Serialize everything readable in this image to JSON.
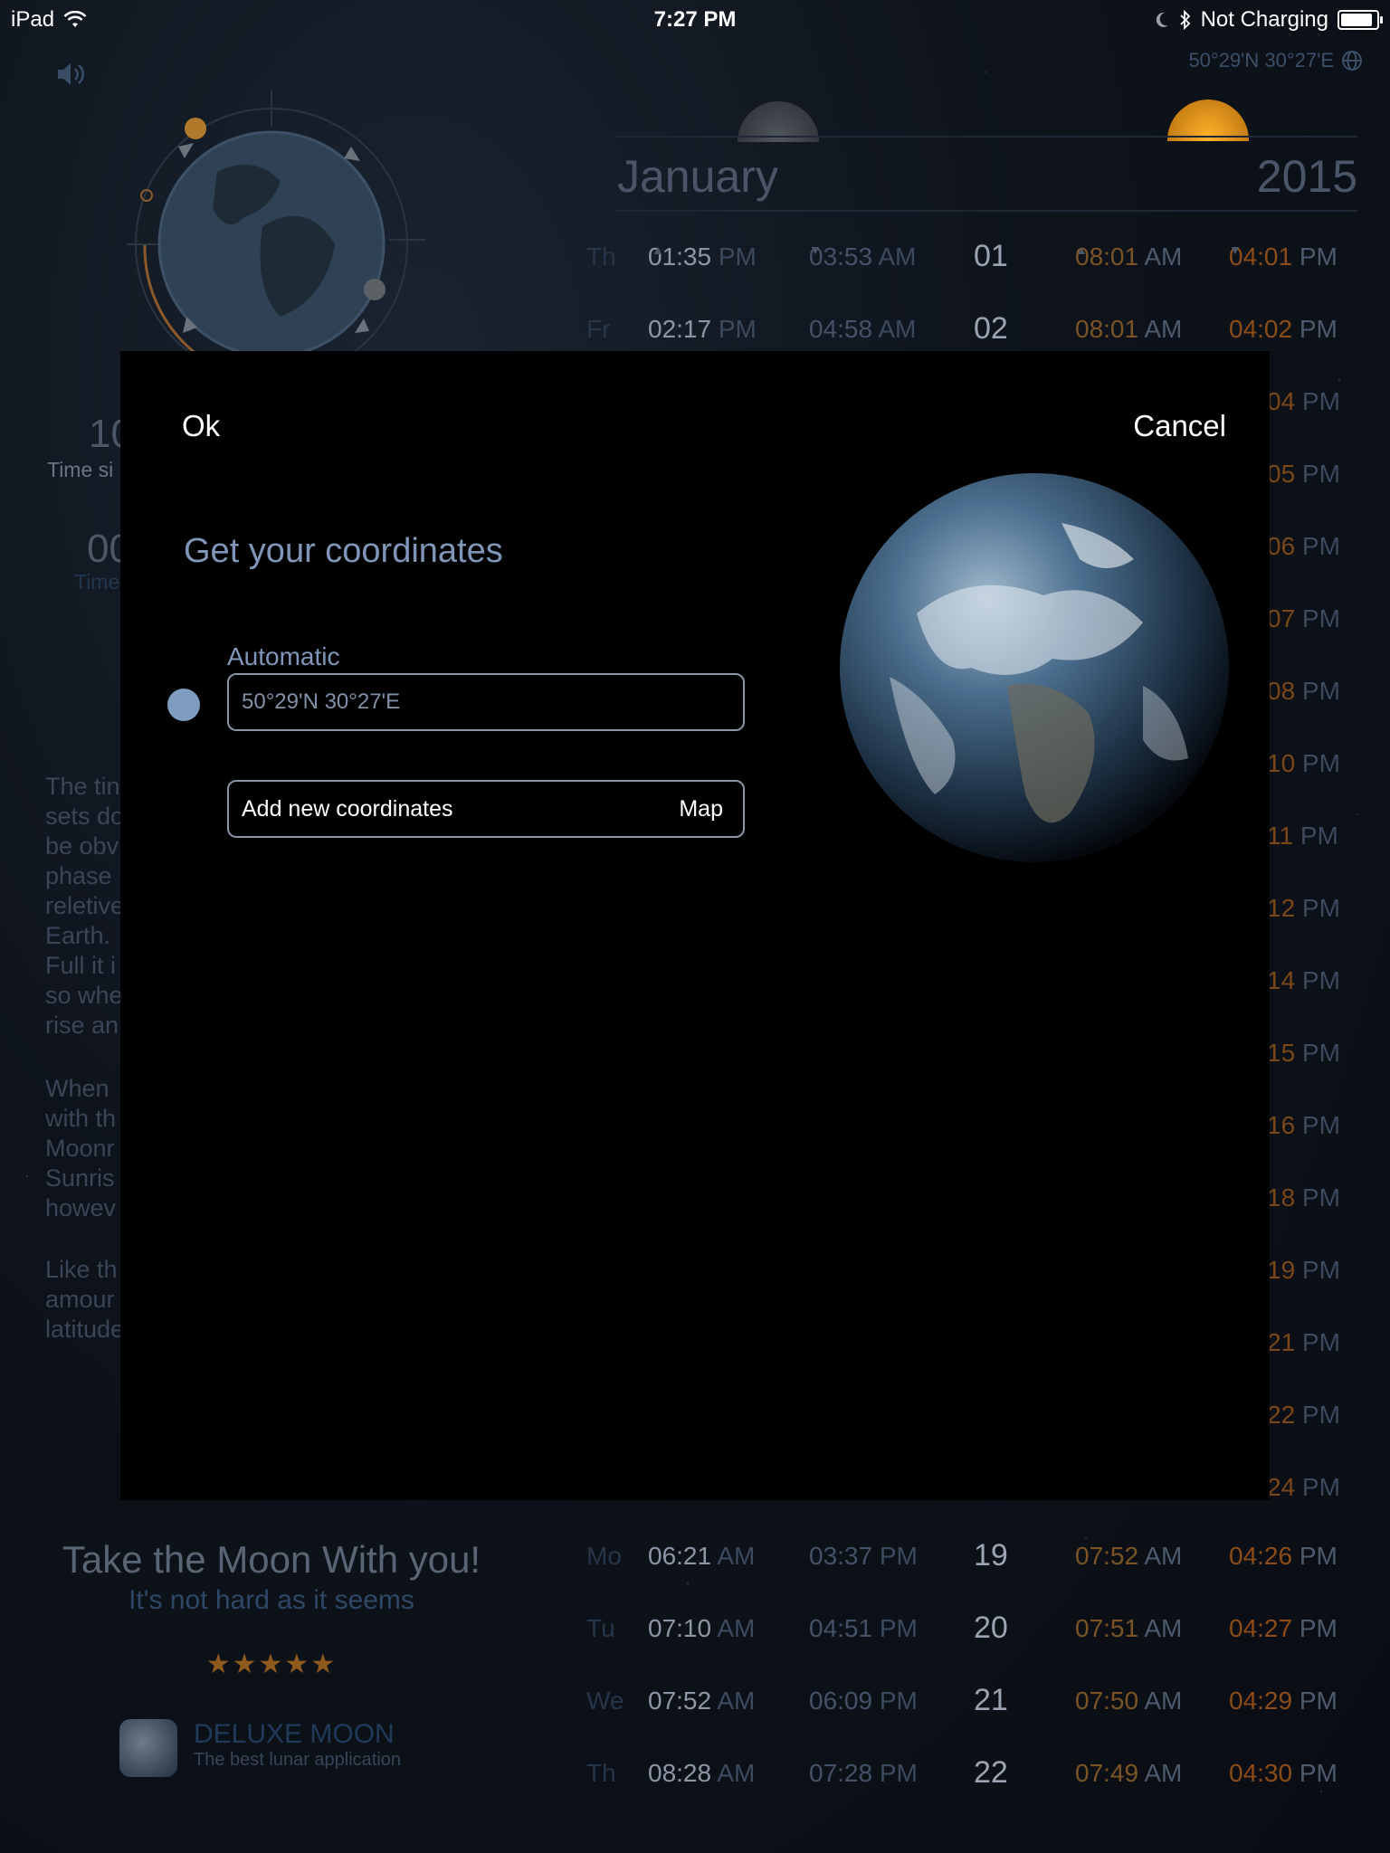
{
  "status_bar": {
    "device": "iPad",
    "time": "7:27 PM",
    "battery": "Not Charging",
    "battery_level": 1.0
  },
  "header": {
    "coordinates": "50°29'N 30°27'E",
    "month": "January",
    "year": "2015"
  },
  "calendar_rows_top": [
    {
      "day": "Th",
      "t1": "01:35",
      "t1s": "PM",
      "t2": "03:53",
      "t2s": "AM",
      "num": "01",
      "t3": "08:01",
      "t3s": "AM",
      "t4": "04:01",
      "t4s": "PM"
    },
    {
      "day": "Fr",
      "t1": "02:17",
      "t1s": "PM",
      "t2": "04:58",
      "t2s": "AM",
      "num": "02",
      "t3": "08:01",
      "t3s": "AM",
      "t4": "04:02",
      "t4s": "PM"
    }
  ],
  "partial_times": [
    {
      "n": "04",
      "s": "PM"
    },
    {
      "n": "05",
      "s": "PM"
    },
    {
      "n": "06",
      "s": "PM"
    },
    {
      "n": "07",
      "s": "PM"
    },
    {
      "n": "08",
      "s": "PM"
    },
    {
      "n": "10",
      "s": "PM"
    },
    {
      "n": "11",
      "s": "PM"
    },
    {
      "n": "12",
      "s": "PM"
    },
    {
      "n": "14",
      "s": "PM"
    },
    {
      "n": "15",
      "s": "PM"
    },
    {
      "n": "16",
      "s": "PM"
    },
    {
      "n": "18",
      "s": "PM"
    },
    {
      "n": "19",
      "s": "PM"
    },
    {
      "n": "21",
      "s": "PM"
    },
    {
      "n": "22",
      "s": "PM"
    },
    {
      "n": "24",
      "s": "PM"
    }
  ],
  "calendar_rows_bottom": [
    {
      "day": "Mo",
      "t1": "06:21",
      "t1s": "AM",
      "t2": "03:37",
      "t2s": "PM",
      "num": "19",
      "t3": "07:52",
      "t3s": "AM",
      "t4": "04:26",
      "t4s": "PM"
    },
    {
      "day": "Tu",
      "t1": "07:10",
      "t1s": "AM",
      "t2": "04:51",
      "t2s": "PM",
      "num": "20",
      "t3": "07:51",
      "t3s": "AM",
      "t4": "04:27",
      "t4s": "PM"
    },
    {
      "day": "We",
      "t1": "07:52",
      "t1s": "AM",
      "t2": "06:09",
      "t2s": "PM",
      "num": "21",
      "t3": "07:50",
      "t3s": "AM",
      "t4": "04:29",
      "t4s": "PM"
    },
    {
      "day": "Th",
      "t1": "08:28",
      "t1s": "AM",
      "t2": "07:28",
      "t2s": "PM",
      "num": "22",
      "t3": "07:49",
      "t3s": "AM",
      "t4": "04:30",
      "t4s": "PM"
    }
  ],
  "left_panel": {
    "stat1_value": "10",
    "stat1_label": "Time si",
    "stat2_value": "00",
    "stat2_label": "Time",
    "text_lines_1": [
      "The tin",
      "sets do",
      "be obv",
      "phase",
      "reletive",
      "Earth.",
      "Full it i",
      "so whe",
      "rise an"
    ],
    "text_lines_2": [
      "When",
      "with th",
      "Moonr",
      "Sunris",
      "howev"
    ],
    "text_lines_3": [
      "Like th",
      "amour",
      "latitude"
    ]
  },
  "promo": {
    "title": "Take the Moon With you!",
    "subtitle": "It's not hard as it seems",
    "stars": "★★★★★",
    "app_name": "DELUXE MOON",
    "app_tagline": "The best lunar application"
  },
  "modal": {
    "ok_label": "Ok",
    "cancel_label": "Cancel",
    "title": "Get your coordinates",
    "automatic_label": "Automatic",
    "automatic_value": "50°29'N 30°27'E",
    "add_label": "Add new coordinates",
    "map_label": "Map"
  },
  "colors": {
    "accent": "#7f96b8",
    "radio": "#7f9dc1",
    "orange": "#8a4c18"
  }
}
